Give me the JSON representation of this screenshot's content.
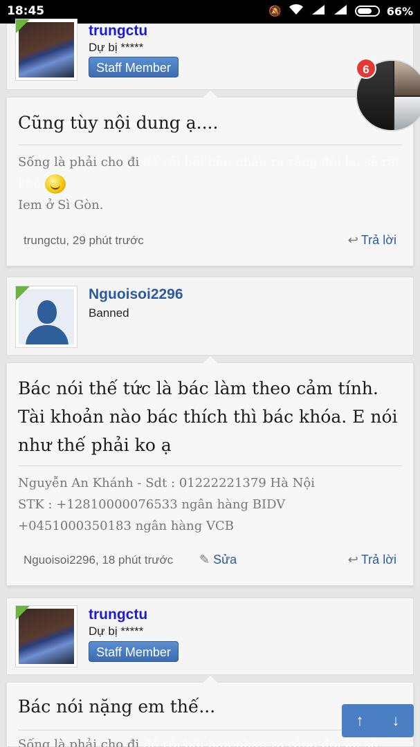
{
  "status_bar": {
    "time": "18:45",
    "battery": "66%",
    "icons": [
      "mute-icon",
      "wifi-icon",
      "signal-icon",
      "signal-icon",
      "battery-icon"
    ]
  },
  "chat_heads": {
    "badge": "6"
  },
  "posts": [
    {
      "author": "trungctu",
      "user_title": "Dự bị *****",
      "badge": "Staff Member",
      "message": "Cũng tùy nội dung ạ....",
      "sig_visible": "Sống là phải cho đi",
      "sig_faded": " để rồi hối hận nhận ra rằng đòi lại sẽ rất khó",
      "sig_line2": "Iem ở Sì Gòn.",
      "meta": "trungctu, 29 phút trước",
      "reply": "Trả lời"
    },
    {
      "author": "Nguoisoi2296",
      "user_title": "Banned",
      "message": "Bác nói thế tức là bác làm theo cảm tính. Tài khoản nào bác thích thì bác khóa. E nói như thế phải ko ạ",
      "sig_lines": [
        "Nguyễn An Khánh - Sdt : 01222221379 Hà Nội",
        "STK : +12810000076533 ngân hàng BIDV",
        "+0451000350183 ngân hàng VCB"
      ],
      "meta": "Nguoisoi2296, 18 phút trước",
      "edit": "Sửa",
      "reply": "Trả lời"
    },
    {
      "author": "trungctu",
      "user_title": "Dự bị *****",
      "badge": "Staff Member",
      "message": "Bác nói nặng em thế...",
      "sig_visible": "Sống là phải cho đi",
      "sig_faded": " để rồi hối hận nhận ra rằng đòi lại sẽ"
    }
  ],
  "nav": {
    "up": "↑",
    "down": "↓"
  }
}
